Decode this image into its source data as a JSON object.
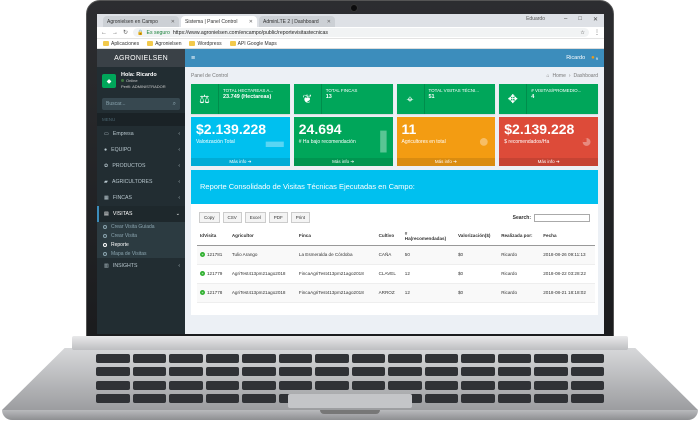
{
  "browser": {
    "tabs": [
      {
        "label": "Agronielsen en Campo"
      },
      {
        "label": "Sistema | Panel Control"
      },
      {
        "label": "AdminLTE 2 | Dashboard"
      }
    ],
    "window_user": "Eduardo",
    "secure_label": "Es seguro",
    "url": "https://www.agronielsen.com/encampo/public/reportevisitastecnicas",
    "bookmarks": [
      "Aplicaciones",
      "Agronielsen",
      "Wordpress",
      "API Google Maps"
    ]
  },
  "sidebar": {
    "logo": "AGRONIELSEN",
    "greeting": "Hola: Ricardo",
    "status": "Online",
    "profile": "Perfil: ADMINISTRADOR",
    "search_placeholder": "Buscar...",
    "menu_header": "MENU",
    "items": [
      {
        "label": "Empresa"
      },
      {
        "label": "EQUIPO"
      },
      {
        "label": "PRODUCTOS"
      },
      {
        "label": "AGRICULTORES"
      },
      {
        "label": "FINCAS"
      },
      {
        "label": "VISITAS"
      }
    ],
    "subitems": [
      {
        "label": "Crear Visita Guiada"
      },
      {
        "label": "Crear Visita"
      },
      {
        "label": "Reporte"
      },
      {
        "label": "Mapa de Visitas"
      }
    ],
    "insights": "INSIGHTS"
  },
  "topbar": {
    "user": "Ricardo",
    "badge": "9"
  },
  "breadcrumb": {
    "title": "Panel de Control",
    "home": "Home",
    "page": "Dashboard"
  },
  "infoboxes": [
    {
      "title": "TOTAL HECTAREAS A...",
      "value": "23.749 (Hectareas)"
    },
    {
      "title": "TOTAL FINCAS",
      "value": "13"
    },
    {
      "title": "TOTAL VISITAS TÉCNI...",
      "value": "51"
    },
    {
      "title": "# VISITAS/PROMEDIO...",
      "value": "4"
    }
  ],
  "statboxes": [
    {
      "value": "$2.139.228",
      "label": "Valorización Total",
      "color": "#00c0ef"
    },
    {
      "value": "24.694",
      "label": "# Ha bajo recomendación",
      "color": "#00a65a"
    },
    {
      "value": "11",
      "label": "Agricultores en total",
      "color": "#f39c12"
    },
    {
      "value": "$2.139.228",
      "label": "$ recomendados/Ha",
      "color": "#dd4b39"
    }
  ],
  "more_info": "Más info",
  "report": {
    "title": "Reporte Consolidado de Visitas Técnicas Ejecutadas en Campo:",
    "buttons": [
      "Copy",
      "CSV",
      "Excel",
      "PDF",
      "Print"
    ],
    "search_label": "Search:",
    "columns": [
      "IdVisita",
      "Agricultor",
      "Finca",
      "Cultivo",
      "#\nHa(recomendadas)",
      "Valorización($)",
      "Realizada por:",
      "Fecha"
    ],
    "rows": [
      [
        "121781",
        "Tulio Arango",
        "La Esmeralda de Córdoba",
        "CAÑA",
        "50",
        "$0",
        "Ricardo",
        "2018-08-26 09:11:13"
      ],
      [
        "121779",
        "AgriTest413pm21ago2018",
        "FincaAgriTest413pm21ago2018",
        "CLAVEL",
        "12",
        "$0",
        "Ricardo",
        "2018-08-22 03:28:22"
      ],
      [
        "121778",
        "AgriTest413pm21ago2018",
        "FincaAgriTest413pm21ago2018",
        "ARROZ",
        "12",
        "$0",
        "Ricardo",
        "2018-08-21 18:18:02"
      ]
    ]
  }
}
